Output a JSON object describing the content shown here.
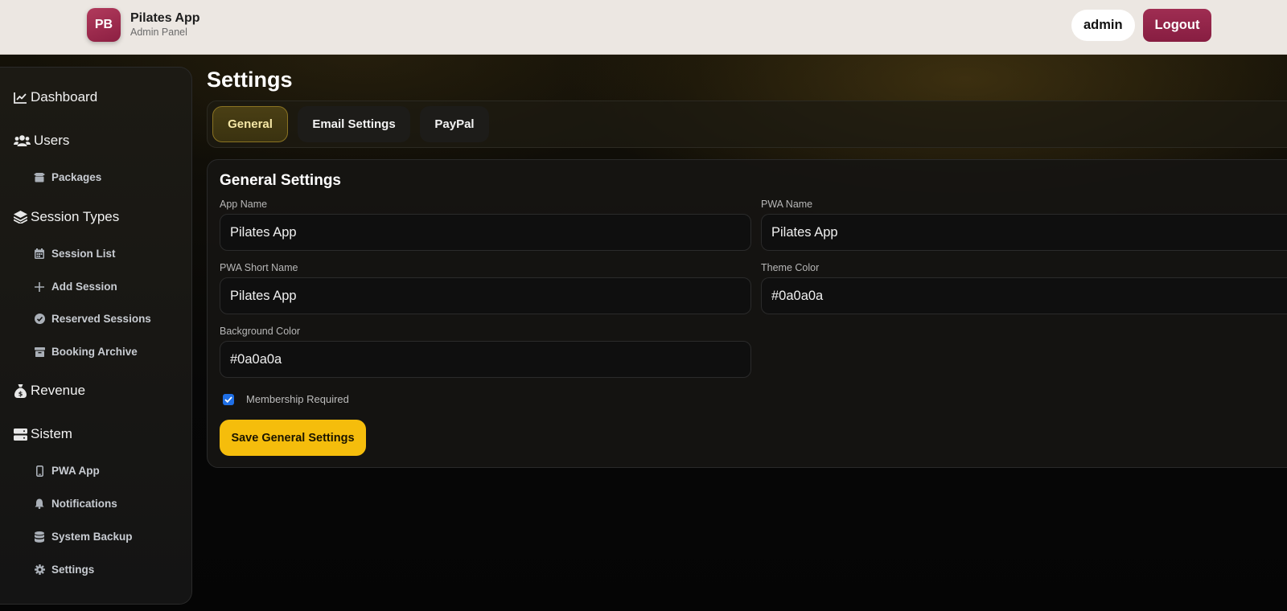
{
  "header": {
    "logo_text": "PB",
    "app_title": "Pilates App",
    "app_subtitle": "Admin Panel",
    "user_label": "admin",
    "logout_label": "Logout"
  },
  "sidebar": {
    "items": [
      {
        "label": "Dashboard",
        "icon": "chart-line-icon",
        "level": "main"
      },
      {
        "label": "Users",
        "icon": "users-icon",
        "level": "main"
      },
      {
        "label": "Packages",
        "icon": "box-icon",
        "level": "sub"
      },
      {
        "label": "Session Types",
        "icon": "layers-icon",
        "level": "main"
      },
      {
        "label": "Session List",
        "icon": "calendar-icon",
        "level": "sub"
      },
      {
        "label": "Add Session",
        "icon": "plus-icon",
        "level": "sub"
      },
      {
        "label": "Reserved Sessions",
        "icon": "check-circle-icon",
        "level": "sub"
      },
      {
        "label": "Booking Archive",
        "icon": "archive-icon",
        "level": "sub"
      },
      {
        "label": "Revenue",
        "icon": "money-bag-icon",
        "level": "main"
      },
      {
        "label": "Sistem",
        "icon": "server-icon",
        "level": "main"
      },
      {
        "label": "PWA App",
        "icon": "mobile-icon",
        "level": "sub"
      },
      {
        "label": "Notifications",
        "icon": "bell-icon",
        "level": "sub"
      },
      {
        "label": "System Backup",
        "icon": "database-icon",
        "level": "sub"
      },
      {
        "label": "Settings",
        "icon": "gear-icon",
        "level": "sub"
      }
    ]
  },
  "page": {
    "title": "Settings",
    "tabs": [
      {
        "label": "General",
        "active": true
      },
      {
        "label": "Email Settings",
        "active": false
      },
      {
        "label": "PayPal",
        "active": false
      }
    ]
  },
  "general": {
    "title": "General Settings",
    "app_name": {
      "label": "App Name",
      "value": "Pilates App"
    },
    "pwa_name": {
      "label": "PWA Name",
      "value": "Pilates App"
    },
    "pwa_short_name": {
      "label": "PWA Short Name",
      "value": "Pilates App"
    },
    "theme_color": {
      "label": "Theme Color",
      "value": "#0a0a0a"
    },
    "background_color": {
      "label": "Background Color",
      "value": "#0a0a0a"
    },
    "membership_required": {
      "label": "Membership Required",
      "checked": true
    },
    "save_label": "Save General Settings"
  },
  "colors": {
    "accent": "#f5bd0c",
    "brand": "#8c1f42",
    "checkbox": "#1f6fe6"
  }
}
